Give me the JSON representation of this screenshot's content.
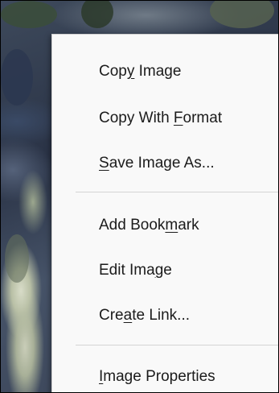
{
  "context_menu": {
    "items": [
      {
        "before": "Cop",
        "key": "y",
        "after": " Image"
      },
      {
        "before": "Copy With ",
        "key": "F",
        "after": "ormat"
      },
      {
        "before": "",
        "key": "S",
        "after": "ave Image As..."
      },
      {
        "before": "Add Book",
        "key": "m",
        "after": "ark"
      },
      {
        "before": "Edit Ima",
        "key": "g",
        "after": "e"
      },
      {
        "before": "Cre",
        "key": "a",
        "after": "te Link..."
      },
      {
        "before": "",
        "key": "I",
        "after": "mage Properties"
      }
    ]
  },
  "colors": {
    "menu_background": "#f9f9f9",
    "menu_text": "#1b1b1b",
    "separator": "#d4d4d4"
  }
}
